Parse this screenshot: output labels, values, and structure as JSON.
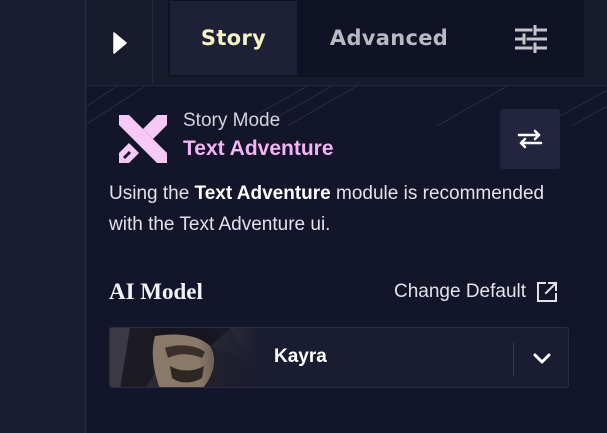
{
  "tabs": [
    {
      "label": "Story",
      "active": true
    },
    {
      "label": "Advanced",
      "active": false
    }
  ],
  "icons": {
    "sidebar_toggle": "play-triangle-icon",
    "settings": "sliders-icon",
    "mode": "crossed-swords-icon",
    "swap": "swap-arrows-icon",
    "external": "external-link-icon",
    "dropdown": "chevron-down-icon"
  },
  "story_mode": {
    "label": "Story Mode",
    "value": "Text Adventure"
  },
  "description": {
    "prefix": "Using the ",
    "module": "Text Adventure",
    "suffix": " module is recommended with the Text Adventure ui."
  },
  "ai_model": {
    "heading": "AI Model",
    "change_default": "Change Default",
    "selected_model": "Kayra"
  },
  "colors": {
    "accent_pink": "#f3b4f3",
    "active_tab_text": "#f5f3c2",
    "panel_bg": "#13152a",
    "icon_pink": "#f6c8f6"
  }
}
